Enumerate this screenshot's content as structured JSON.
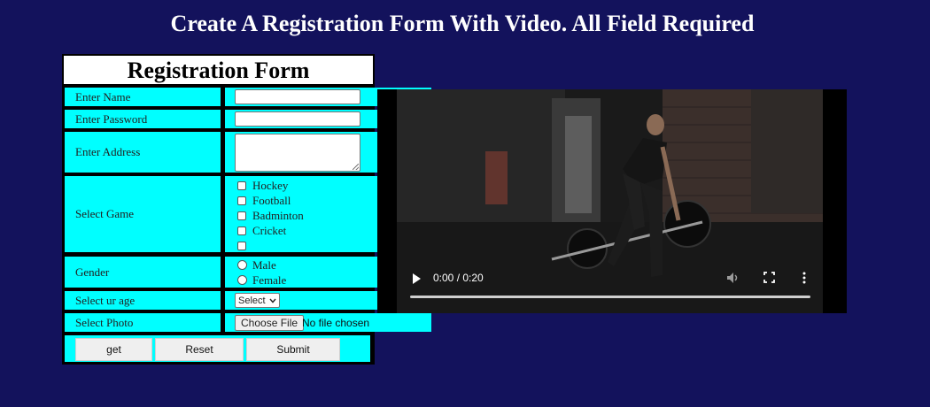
{
  "page": {
    "title": "Create A Registration Form With Video. All Field Required"
  },
  "form": {
    "heading": "Registration Form",
    "labels": {
      "name": "Enter Name",
      "password": "Enter Password",
      "address": "Enter Address",
      "game": "Select Game",
      "gender": "Gender",
      "age": "Select ur age",
      "photo": "Select Photo"
    },
    "games": [
      "Hockey",
      "Football",
      "Badminton",
      "Cricket",
      ""
    ],
    "genders": [
      "Male",
      "Female"
    ],
    "age_select": "Select",
    "file": {
      "button": "Choose File",
      "status": "No file chosen"
    },
    "buttons": {
      "get": "get",
      "reset": "Reset",
      "submit": "Submit"
    },
    "colors": {
      "cell": "#00ffff",
      "background": "#13125c"
    }
  },
  "video": {
    "time": "0:00 / 0:20",
    "progress": 0
  }
}
